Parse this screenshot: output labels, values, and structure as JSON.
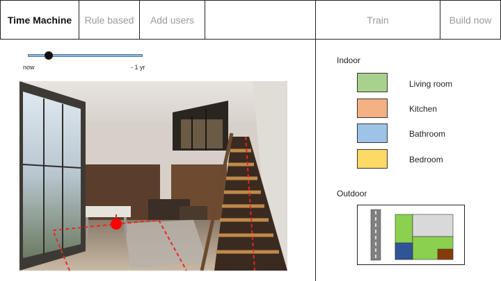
{
  "tabs": [
    {
      "label": "Time Machine",
      "active": true
    },
    {
      "label": "Rule based",
      "active": false
    },
    {
      "label": "Add users",
      "active": false
    },
    {
      "label": "",
      "active": false
    },
    {
      "label": "Train",
      "active": false
    },
    {
      "label": "Build now",
      "active": false
    }
  ],
  "slider": {
    "start_label": "now",
    "end_label": "- 1 yr",
    "value_fraction": 0.18
  },
  "indoor": {
    "title": "Indoor",
    "rooms": [
      {
        "label": "Living room",
        "color": "#a8d18d"
      },
      {
        "label": "Kitchen",
        "color": "#f4b183"
      },
      {
        "label": "Bathroom",
        "color": "#9dc3e6"
      },
      {
        "label": "Bedroom",
        "color": "#ffd966"
      }
    ]
  },
  "outdoor": {
    "title": "Outdoor",
    "colors": {
      "road": "#808080",
      "lawn": "#8bd04e",
      "building": "#d9d9d9",
      "pool": "#2f5597",
      "shed": "#843c0c"
    }
  },
  "room_view": {
    "marker_color": "#ff0000",
    "path_color": "#e8261f"
  }
}
